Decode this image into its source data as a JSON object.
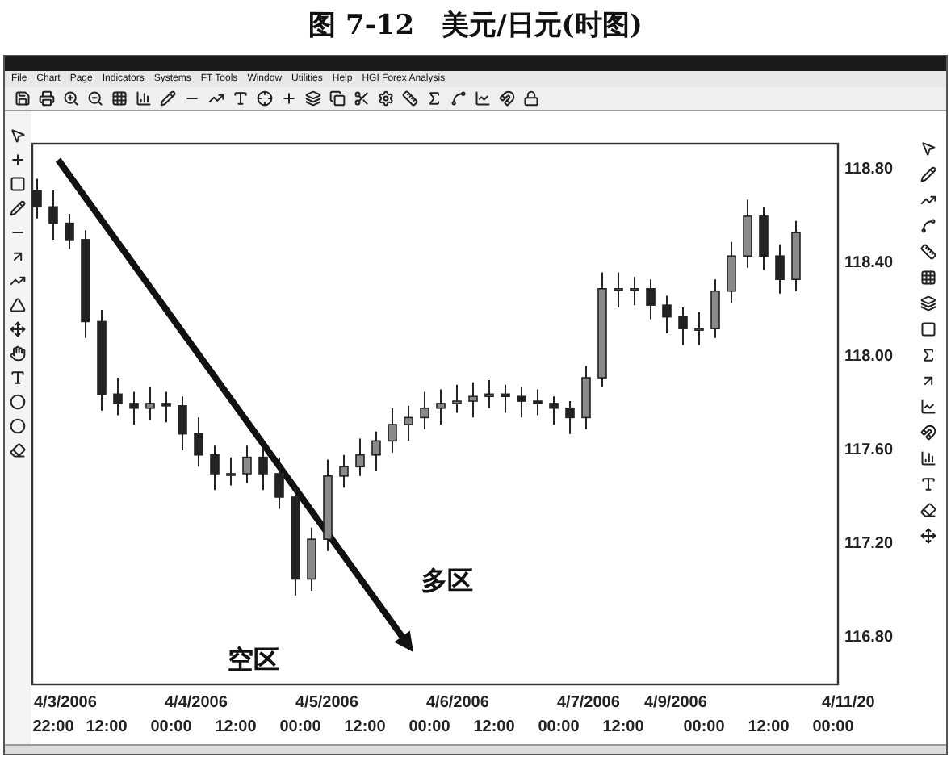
{
  "figure_caption": "图 7-12　美元/日元(时图)",
  "menu": [
    {
      "label": "File"
    },
    {
      "label": "Chart"
    },
    {
      "label": "Page"
    },
    {
      "label": "Indicators"
    },
    {
      "label": "Systems"
    },
    {
      "label": "FT Tools"
    },
    {
      "label": "Window"
    },
    {
      "label": "Utilities"
    },
    {
      "label": "Help"
    },
    {
      "label": "HGI Forex Analysis"
    }
  ],
  "chart": {
    "chart_data": {
      "type": "candlestick",
      "ylim": [
        116.59,
        118.9
      ],
      "yticks": [
        {
          "value": 118.8,
          "label": "118.80"
        },
        {
          "value": 118.4,
          "label": "118.40"
        },
        {
          "value": 118,
          "label": "118.00"
        },
        {
          "value": 117.6,
          "label": "117.60"
        },
        {
          "value": 117.2,
          "label": "117.20"
        },
        {
          "value": 116.8,
          "label": "116.80"
        }
      ],
      "categories": [
        null,
        null,
        null,
        null,
        null,
        null,
        null,
        null,
        null,
        null,
        null,
        null,
        null,
        null,
        null,
        null,
        null,
        null,
        null,
        null,
        null,
        null,
        null,
        null,
        null,
        null,
        null,
        null,
        null,
        null,
        null,
        null,
        null,
        null,
        null,
        null,
        null,
        null,
        null,
        null,
        null,
        null,
        null,
        null,
        null,
        null,
        null,
        null
      ],
      "ohlc": [
        [
          118.7,
          118.75,
          118.58,
          118.63
        ],
        [
          118.63,
          118.7,
          118.49,
          118.56
        ],
        [
          118.56,
          118.6,
          118.45,
          118.49
        ],
        [
          118.49,
          118.53,
          118.07,
          118.14
        ],
        [
          118.14,
          118.19,
          117.76,
          117.83
        ],
        [
          117.83,
          117.9,
          117.74,
          117.79
        ],
        [
          117.79,
          117.84,
          117.7,
          117.77
        ],
        [
          117.77,
          117.86,
          117.72,
          117.79
        ],
        [
          117.79,
          117.84,
          117.71,
          117.78
        ],
        [
          117.78,
          117.82,
          117.59,
          117.66
        ],
        [
          117.66,
          117.73,
          117.52,
          117.57
        ],
        [
          117.57,
          117.61,
          117.42,
          117.49
        ],
        [
          117.49,
          117.56,
          117.44,
          117.49
        ],
        [
          117.49,
          117.61,
          117.45,
          117.56
        ],
        [
          117.56,
          117.6,
          117.42,
          117.49
        ],
        [
          117.49,
          117.56,
          117.34,
          117.39
        ],
        [
          117.39,
          117.43,
          116.97,
          117.04
        ],
        [
          117.04,
          117.26,
          116.99,
          117.21
        ],
        [
          117.21,
          117.55,
          117.16,
          117.48
        ],
        [
          117.48,
          117.57,
          117.43,
          117.52
        ],
        [
          117.52,
          117.64,
          117.48,
          117.57
        ],
        [
          117.57,
          117.67,
          117.5,
          117.63
        ],
        [
          117.63,
          117.77,
          117.58,
          117.7
        ],
        [
          117.7,
          117.78,
          117.63,
          117.73
        ],
        [
          117.73,
          117.84,
          117.68,
          117.77
        ],
        [
          117.77,
          117.85,
          117.7,
          117.79
        ],
        [
          117.79,
          117.87,
          117.75,
          117.8
        ],
        [
          117.8,
          117.88,
          117.73,
          117.82
        ],
        [
          117.82,
          117.89,
          117.77,
          117.83
        ],
        [
          117.83,
          117.87,
          117.75,
          117.82
        ],
        [
          117.82,
          117.86,
          117.73,
          117.8
        ],
        [
          117.8,
          117.85,
          117.74,
          117.79
        ],
        [
          117.79,
          117.82,
          117.7,
          117.77
        ],
        [
          117.77,
          117.8,
          117.66,
          117.73
        ],
        [
          117.73,
          117.95,
          117.68,
          117.9
        ],
        [
          117.9,
          118.35,
          117.86,
          118.28
        ],
        [
          118.28,
          118.35,
          118.2,
          118.28
        ],
        [
          118.28,
          118.33,
          118.21,
          118.28
        ],
        [
          118.28,
          118.32,
          118.15,
          118.21
        ],
        [
          118.21,
          118.25,
          118.09,
          118.16
        ],
        [
          118.16,
          118.2,
          118.04,
          118.11
        ],
        [
          118.11,
          118.18,
          118.04,
          118.11
        ],
        [
          118.11,
          118.32,
          118.07,
          118.27
        ],
        [
          118.27,
          118.48,
          118.22,
          118.42
        ],
        [
          118.42,
          118.66,
          118.37,
          118.59
        ],
        [
          118.59,
          118.63,
          118.36,
          118.42
        ],
        [
          118.42,
          118.47,
          118.26,
          118.32
        ],
        [
          118.32,
          118.57,
          118.27,
          118.52
        ]
      ]
    },
    "date_labels": [
      "4/3/2006",
      "4/4/2006",
      "4/5/2006",
      "4/6/2006",
      "4/7/2006",
      "4/9/2006",
      "4/11/20"
    ],
    "time_labels": [
      "22:00",
      "12:00",
      "00:00",
      "12:00",
      "00:00",
      "12:00",
      "00:00",
      "12:00",
      "00:00",
      "12:00",
      "00:00",
      "12:00",
      "00:00"
    ],
    "zone_labels": [
      "空区",
      "多区"
    ]
  }
}
